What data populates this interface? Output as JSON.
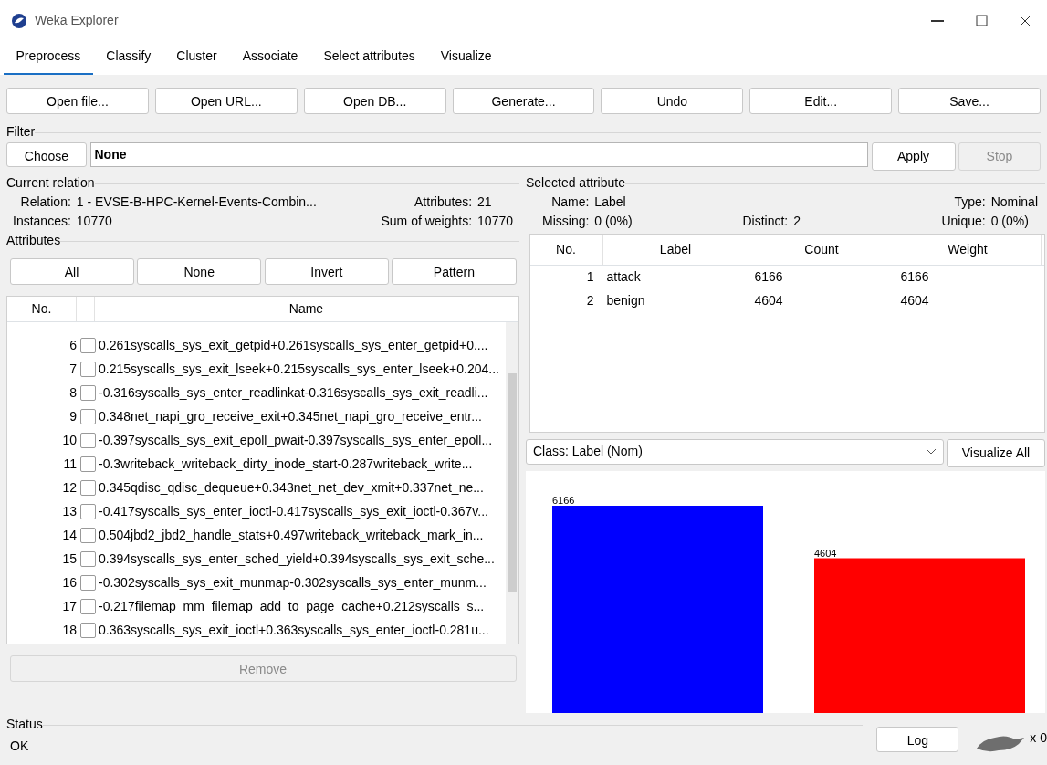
{
  "window": {
    "title": "Weka Explorer"
  },
  "tabs": [
    {
      "label": "Preprocess",
      "selected": true
    },
    {
      "label": "Classify",
      "selected": false
    },
    {
      "label": "Cluster",
      "selected": false
    },
    {
      "label": "Associate",
      "selected": false
    },
    {
      "label": "Select attributes",
      "selected": false
    },
    {
      "label": "Visualize",
      "selected": false
    }
  ],
  "toolbar_buttons": [
    "Open file...",
    "Open URL...",
    "Open DB...",
    "Generate...",
    "Undo",
    "Edit...",
    "Save..."
  ],
  "filter": {
    "title": "Filter",
    "choose_button": "Choose",
    "value": "None",
    "apply_button": "Apply",
    "stop_button": "Stop",
    "stop_disabled": true
  },
  "current_relation": {
    "title": "Current relation",
    "fields": [
      {
        "label": "Relation:",
        "value": "1 - EVSE-B-HPC-Kernel-Events-Combin..."
      },
      {
        "label": "Attributes:",
        "value": "21"
      },
      {
        "label": "Instances:",
        "value": "10770"
      },
      {
        "label": "Sum of weights:",
        "value": "10770"
      }
    ]
  },
  "attributes": {
    "title": "Attributes",
    "buttons": [
      "All",
      "None",
      "Invert",
      "Pattern"
    ],
    "columns": [
      "No.",
      "Name"
    ],
    "rows": [
      {
        "no": "6",
        "name": "0.261syscalls_sys_exit_getpid+0.261syscalls_sys_enter_getpid+0....",
        "checked": false
      },
      {
        "no": "7",
        "name": "0.215syscalls_sys_exit_lseek+0.215syscalls_sys_enter_lseek+0.204...",
        "checked": false
      },
      {
        "no": "8",
        "name": "-0.316syscalls_sys_enter_readlinkat-0.316syscalls_sys_exit_readli...",
        "checked": false
      },
      {
        "no": "9",
        "name": "0.348net_napi_gro_receive_exit+0.345net_napi_gro_receive_entr...",
        "checked": false
      },
      {
        "no": "10",
        "name": "-0.397syscalls_sys_exit_epoll_pwait-0.397syscalls_sys_enter_epoll...",
        "checked": false
      },
      {
        "no": "11",
        "name": "-0.3writeback_writeback_dirty_inode_start-0.287writeback_write...",
        "checked": false
      },
      {
        "no": "12",
        "name": "0.345qdisc_qdisc_dequeue+0.343net_net_dev_xmit+0.337net_ne...",
        "checked": false
      },
      {
        "no": "13",
        "name": "-0.417syscalls_sys_enter_ioctl-0.417syscalls_sys_exit_ioctl-0.367v...",
        "checked": false
      },
      {
        "no": "14",
        "name": "0.504jbd2_jbd2_handle_stats+0.497writeback_writeback_mark_in...",
        "checked": false
      },
      {
        "no": "15",
        "name": "0.394syscalls_sys_enter_sched_yield+0.394syscalls_sys_exit_sche...",
        "checked": false
      },
      {
        "no": "16",
        "name": "-0.302syscalls_sys_exit_munmap-0.302syscalls_sys_enter_munm...",
        "checked": false
      },
      {
        "no": "17",
        "name": "-0.217filemap_mm_filemap_add_to_page_cache+0.212syscalls_s...",
        "checked": false
      },
      {
        "no": "18",
        "name": "0.363syscalls_sys_exit_ioctl+0.363syscalls_sys_enter_ioctl-0.281u...",
        "checked": false
      }
    ],
    "remove_button": "Remove",
    "remove_disabled": true
  },
  "selected_attribute": {
    "title": "Selected attribute",
    "fields": [
      {
        "label": "Name:",
        "value": "Label"
      },
      {
        "label": "Type:",
        "value": "Nominal"
      },
      {
        "label": "Missing:",
        "value": "0 (0%)"
      },
      {
        "label": "Distinct:",
        "value": "2"
      },
      {
        "label": "Unique:",
        "value": "0 (0%)"
      }
    ],
    "table": {
      "columns": [
        "No.",
        "Label",
        "Count",
        "Weight"
      ],
      "rows": [
        [
          "1",
          "attack",
          "6166",
          "6166"
        ],
        [
          "2",
          "benign",
          "4604",
          "4604"
        ]
      ]
    }
  },
  "class_select": {
    "value": "Class: Label (Nom)"
  },
  "visualize_all_button": "Visualize All",
  "chart_data": {
    "type": "bar",
    "stacked": true,
    "data_labels": true,
    "series": [
      {
        "color": "#0000ff",
        "values": [
          6166,
          null
        ]
      },
      {
        "color": "#ff0000",
        "values": [
          null,
          4604
        ]
      }
    ]
  },
  "status": {
    "title": "Status",
    "text": "OK"
  },
  "log_button": "Log",
  "task_count": "x 0"
}
